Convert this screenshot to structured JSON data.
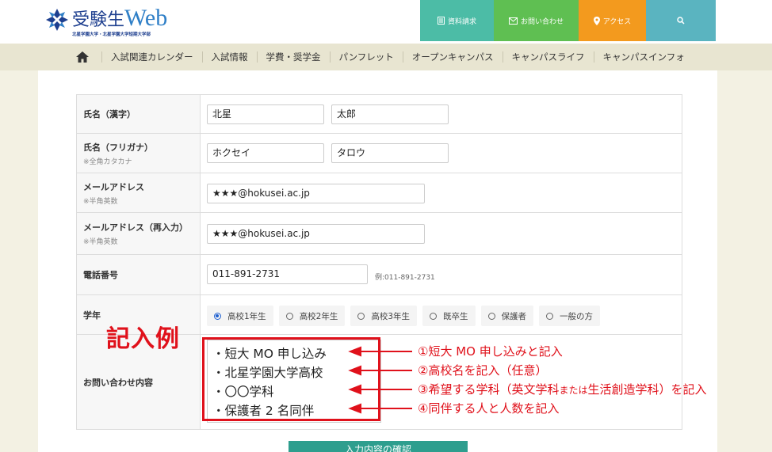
{
  "header": {
    "logo_title": "受験生",
    "logo_web": "Web",
    "logo_subtitle": "北星学園大学・北星学園大学短期大学部",
    "doc_button": "資料請求",
    "contact_button": "お問い合わせ",
    "access_button": "アクセス"
  },
  "nav": {
    "items": [
      "入試関連カレンダー",
      "入試情報",
      "学費・奨学金",
      "パンフレット",
      "オープンキャンパス",
      "キャンパスライフ",
      "キャンパスインフォ"
    ]
  },
  "form": {
    "name_kanji": {
      "label": "氏名（漢字）",
      "last": "北星",
      "first": "太郎"
    },
    "name_kana": {
      "label": "氏名（フリガナ）",
      "note": "※全角カタカナ",
      "last": "ホクセイ",
      "first": "タロウ"
    },
    "email": {
      "label": "メールアドレス",
      "note": "※半角英数",
      "value": "★★★@hokusei.ac.jp"
    },
    "email_confirm": {
      "label": "メールアドレス（再入力）",
      "note": "※半角英数",
      "value": "★★★@hokusei.ac.jp"
    },
    "phone": {
      "label": "電話番号",
      "value": "011-891-2731",
      "example": "例:011-891-2731"
    },
    "grade": {
      "label": "学年",
      "options": [
        "高校1年生",
        "高校2年生",
        "高校3年生",
        "既卒生",
        "保護者",
        "一般の方"
      ],
      "selected_index": 0
    },
    "inquiry": {
      "label": "お問い合わせ内容"
    },
    "submit": "入力内容の確認"
  },
  "annotation": {
    "heading": "記入例",
    "lines": [
      "・短大 MO 申し込み",
      "・北星学園大学高校",
      "・〇〇学科",
      "・保護者 2 名同伴"
    ],
    "notes": [
      "①短大 MO 申し込みと記入",
      "②高校名を記入（任意）",
      {
        "pre": "③希望する学科（英文学科",
        "small": "または",
        "post": "生活創造学科）を記入"
      },
      "④同伴する人と人数を記入"
    ],
    "accent_color": "#e0111b"
  }
}
